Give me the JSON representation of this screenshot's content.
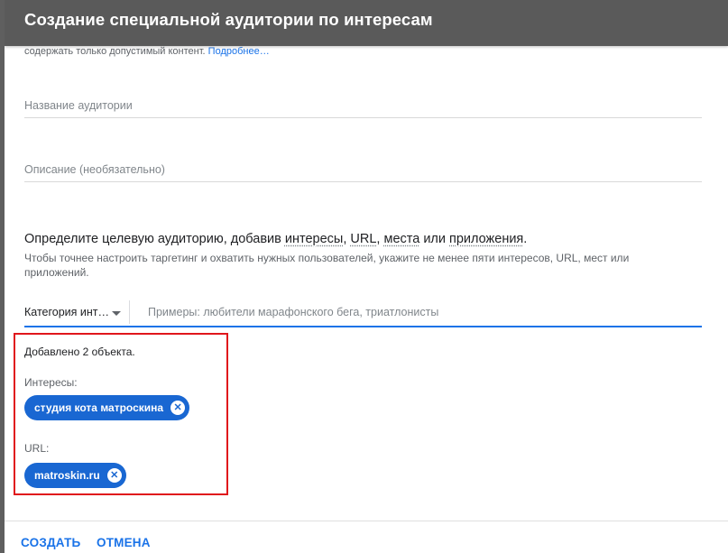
{
  "dialog": {
    "title": "Создание специальной аудитории по интересам",
    "note_text": "содержать только допустимый контент.",
    "note_link": "Подробнее…"
  },
  "fields": {
    "name_placeholder": "Название аудитории",
    "description_placeholder": "Описание (необязательно)"
  },
  "targeting": {
    "title_prefix": "Определите целевую аудиторию, добавив ",
    "interests": "интересы",
    "sep1": ", ",
    "url": "URL",
    "sep2": ", ",
    "places": "места",
    "or": " или ",
    "apps": "приложения",
    "end": ".",
    "subtitle": "Чтобы точнее настроить таргетинг и охватить нужных пользователей, укажите не менее пяти интересов, URL, мест или приложений."
  },
  "search": {
    "category_label": "Категория инт…",
    "placeholder": "Примеры: любители марафонского бега, триатлонисты"
  },
  "added": {
    "count_text": "Добавлено 2 объекта.",
    "interests_label": "Интересы:",
    "interest_chip": "студия кота матроскина",
    "url_label": "URL:",
    "url_chip": "matroskin.ru",
    "remove_glyph": "✕"
  },
  "buttons": {
    "create": "СОЗДАТЬ",
    "cancel": "ОТМЕНА"
  },
  "colors": {
    "header_bg": "#5a5a5a",
    "accent": "#1a73e8",
    "chip_bg": "#1967d2",
    "highlight_border": "#e0161c"
  },
  "icons": {
    "dropdown": "caret-down-icon",
    "chip_remove": "close-circle-icon"
  }
}
